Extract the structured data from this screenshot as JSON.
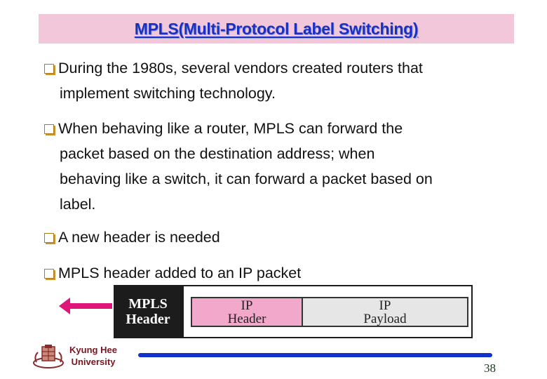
{
  "slide": {
    "title": "MPLS(Multi-Protocol Label Switching)",
    "bullets": [
      {
        "icon": "checkbox-bullet-icon",
        "lines": [
          "During the 1980s, several vendors created routers that",
          "implement switching technology."
        ]
      },
      {
        "icon": "checkbox-bullet-icon",
        "lines": [
          "When behaving like a router, MPLS can forward the",
          "packet based on the destination address; when",
          "behaving like a switch, it can forward a packet based on",
          "label."
        ]
      },
      {
        "icon": "checkbox-bullet-icon",
        "lines": [
          "A new header is needed"
        ]
      },
      {
        "icon": "checkbox-bullet-icon",
        "lines": [
          "MPLS header added to an IP packet"
        ]
      }
    ],
    "diagram": {
      "arrow_icon": "left-arrow-icon",
      "arrow_color": "#e0157a",
      "mpls_header": [
        "MPLS",
        "Header"
      ],
      "ip_header": [
        "IP",
        "Header"
      ],
      "ip_payload": [
        "IP",
        "Payload"
      ],
      "colors": {
        "mpls_block": "#1c1c1c",
        "ip_header": "#f2a8cb",
        "ip_payload": "#e6e6e6"
      }
    },
    "footer": {
      "logo_icon": "university-crest-icon",
      "university_line1": "Kyung Hee",
      "university_line2": "University",
      "page_number": "38"
    },
    "colors": {
      "title_bg": "#f2c7d9",
      "title_text": "#1a2fc4",
      "footer_line": "#1133cc",
      "university_text": "#7a1420"
    }
  }
}
